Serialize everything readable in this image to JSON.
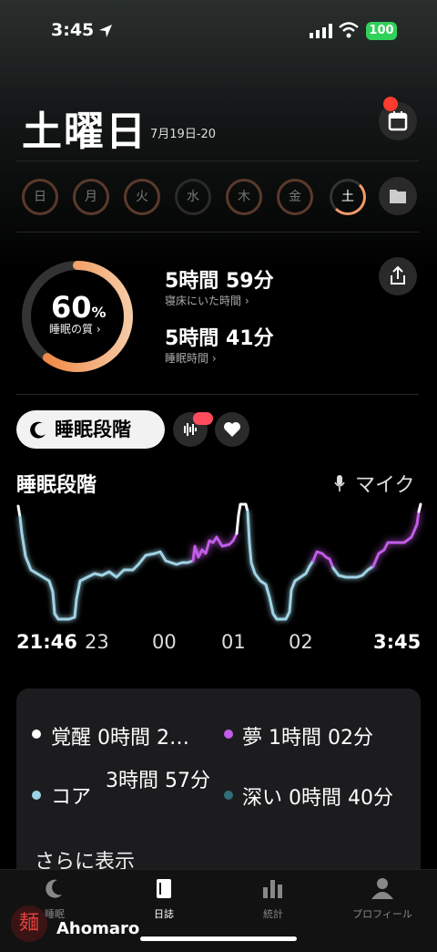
{
  "status": {
    "time": "3:45",
    "battery": "100"
  },
  "header": {
    "day": "土曜日",
    "date": "7月19日-20"
  },
  "week": [
    "日",
    "月",
    "火",
    "水",
    "木",
    "金",
    "土"
  ],
  "summary": {
    "quality_value": "60",
    "quality_unit": "%",
    "quality_label": "睡眠の質 ›",
    "in_bed_value": "5時間 59分",
    "in_bed_label": "寝床にいた時間 ›",
    "asleep_value": "5時間 41分",
    "asleep_label": "睡眠時間 ›"
  },
  "tabs_row": {
    "stages_label": "睡眠段階"
  },
  "chart_section": {
    "title": "睡眠段階",
    "mic_label": "マイク"
  },
  "chart_data": {
    "type": "line",
    "x_tick_labels": [
      "21:46",
      "23",
      "00",
      "01",
      "02",
      "3:45"
    ],
    "stage_levels": [
      "覚醒",
      "夢",
      "コア",
      "深い"
    ],
    "colors": {
      "awake": "#ffffff",
      "rem": "#c35ce8",
      "core": "#9fd3e6",
      "deep": "#2f6f76"
    }
  },
  "legend": [
    {
      "name": "覚醒",
      "value": "0時間 2…",
      "color": "#ffffff"
    },
    {
      "name": "夢",
      "value": "1時間 02分",
      "color": "#c35ce8"
    },
    {
      "name": "コア",
      "value": "3時間 57分",
      "color": "#9fd3e6"
    },
    {
      "name": "深い",
      "value": "0時間 40分",
      "color": "#2f6f76"
    }
  ],
  "show_more": "さらに表示",
  "tabbar": [
    {
      "label": "睡眠",
      "icon": "moon-icon"
    },
    {
      "label": "日誌",
      "icon": "journal-icon"
    },
    {
      "label": "統計",
      "icon": "bar-chart-icon"
    },
    {
      "label": "プロフィール",
      "icon": "person-icon"
    }
  ],
  "watermark": {
    "logo": "麺",
    "text": "Ahomaro"
  }
}
